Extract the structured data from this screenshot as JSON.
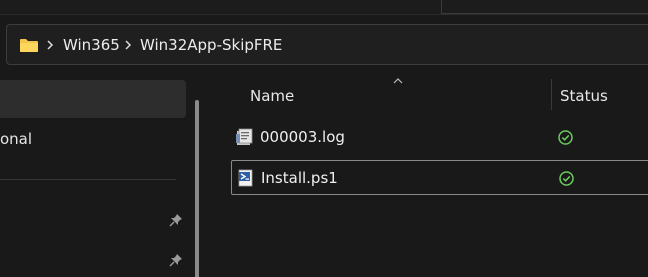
{
  "address": {
    "folder_icon": "folder-icon",
    "breadcrumb": [
      "Win365",
      "Win32App-SkipFRE"
    ]
  },
  "nav": {
    "partial_label": "onal"
  },
  "columns": {
    "name": "Name",
    "status": "Status"
  },
  "files": [
    {
      "name": "000003.log",
      "icon": "log-file-icon",
      "status": "synced-check-icon"
    },
    {
      "name": "Install.ps1",
      "icon": "powershell-script-icon",
      "status": "synced-check-icon"
    }
  ],
  "colors": {
    "background": "#191919",
    "folder": "#f4c64e",
    "status_green": "#6ccb5f",
    "powershell": "#4a90d9"
  }
}
